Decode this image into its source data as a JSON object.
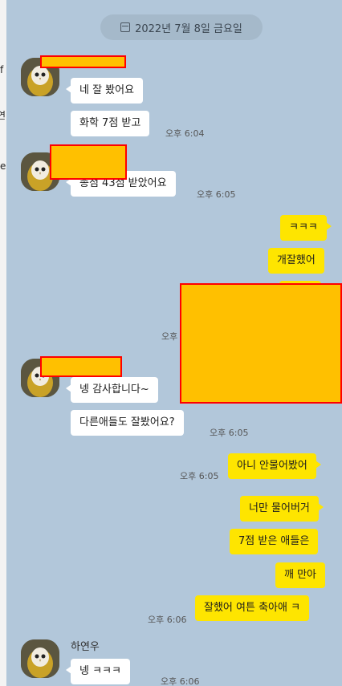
{
  "left_strip": {
    "frag_1": "f",
    "frag_2": "연",
    "frag_3": "e"
  },
  "date_divider": "2022년 7월 8일 금요일",
  "messages": {
    "m1": {
      "text": "네 잘 봤어요"
    },
    "m2": {
      "text": "화학 7점 받고",
      "time": "오후 6:04"
    },
    "m3": {
      "text": "총점 43점 받았어요",
      "time": "오후 6:05"
    },
    "m4": {
      "text": "ㅋㅋㅋ"
    },
    "m5": {
      "text": "개잘했어"
    },
    "m6": {
      "time": "오후"
    },
    "m7": {
      "text": "넹 감사합니다~"
    },
    "m8": {
      "text": "다른애들도 잘봤어요?",
      "time": "오후 6:05"
    },
    "m9": {
      "text": "아니 안물어봤어",
      "time": "오후 6:05"
    },
    "m10": {
      "text": "너만 물어버거"
    },
    "m11": {
      "text": "7점 받은 애들은"
    },
    "m12": {
      "text": "깨 만아"
    },
    "m13": {
      "text": "잘했어 여튼 축아애 ㅋ",
      "time": "오후 6:06"
    },
    "m14": {
      "sender": "하연우",
      "text": "넹 ㅋㅋㅋ",
      "time": "오후 6:06"
    }
  },
  "colors": {
    "chat_bg": "#b2c7da",
    "my_bubble": "#fee500",
    "their_bubble": "#ffffff",
    "redaction_fill": "#ffc000",
    "redaction_border": "#ff0000"
  },
  "icons": {
    "date": "calendar-icon",
    "avatar": "owl-profile-avatar"
  }
}
